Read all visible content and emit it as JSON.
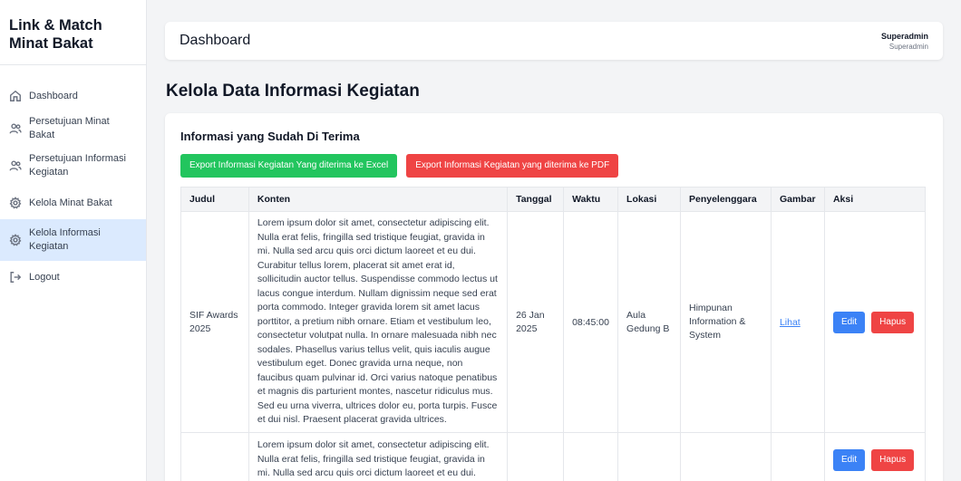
{
  "brand": {
    "line1": "Link & Match",
    "line2": "Minat Bakat"
  },
  "sidebar": {
    "items": [
      {
        "label": "Dashboard",
        "icon": "home-icon"
      },
      {
        "label": "Persetujuan Minat Bakat",
        "icon": "users-icon"
      },
      {
        "label": "Persetujuan Informasi Kegiatan",
        "icon": "users-icon"
      },
      {
        "label": "Kelola Minat Bakat",
        "icon": "gear-icon"
      },
      {
        "label": "Kelola Informasi Kegiatan",
        "icon": "gear-icon",
        "active": true
      },
      {
        "label": "Logout",
        "icon": "logout-icon"
      }
    ]
  },
  "header": {
    "title": "Dashboard",
    "user_name": "Superadmin",
    "user_role": "Superadmin"
  },
  "page": {
    "title": "Kelola Data Informasi Kegiatan",
    "section_title": "Informasi yang Sudah Di Terima",
    "export_excel": "Export Informasi Kegiatan Yang diterima ke Excel",
    "export_pdf": "Export Informasi Kegiatan yang diterima ke PDF"
  },
  "table": {
    "headers": [
      "Judul",
      "Konten",
      "Tanggal",
      "Waktu",
      "Lokasi",
      "Penyelenggara",
      "Gambar",
      "Aksi"
    ],
    "rows": [
      {
        "judul": "SIF Awards 2025",
        "konten": "Lorem ipsum dolor sit amet, consectetur adipiscing elit. Nulla erat felis, fringilla sed tristique feugiat, gravida in mi. Nulla sed arcu quis orci dictum laoreet et eu dui. Curabitur tellus lorem, placerat sit amet erat id, sollicitudin auctor tellus. Suspendisse commodo lectus ut lacus congue interdum. Nullam dignissim neque sed erat porta commodo. Integer gravida lorem sit amet lacus porttitor, a pretium nibh ornare. Etiam et vestibulum leo, consectetur volutpat nulla. In ornare malesuada nibh nec sodales. Phasellus varius tellus velit, quis iaculis augue vestibulum eget. Donec gravida urna neque, non faucibus quam pulvinar id. Orci varius natoque penatibus et magnis dis parturient montes, nascetur ridiculus mus. Sed eu urna viverra, ultrices dolor eu, porta turpis. Fusce et dui nisl. Praesent placerat gravida ultrices.",
        "tanggal": "26 Jan 2025",
        "waktu": "08:45:00",
        "lokasi": "Aula Gedung B",
        "penyelenggara": "Himpunan Information & System",
        "gambar": "Lihat",
        "edit": "Edit",
        "hapus": "Hapus"
      },
      {
        "judul": "",
        "konten": "Lorem ipsum dolor sit amet, consectetur adipiscing elit. Nulla erat felis, fringilla sed tristique feugiat, gravida in mi. Nulla sed arcu quis orci dictum laoreet et eu dui.",
        "tanggal": "",
        "waktu": "",
        "lokasi": "",
        "penyelenggara": "",
        "gambar": "",
        "edit": "Edit",
        "hapus": "Hapus"
      }
    ]
  }
}
